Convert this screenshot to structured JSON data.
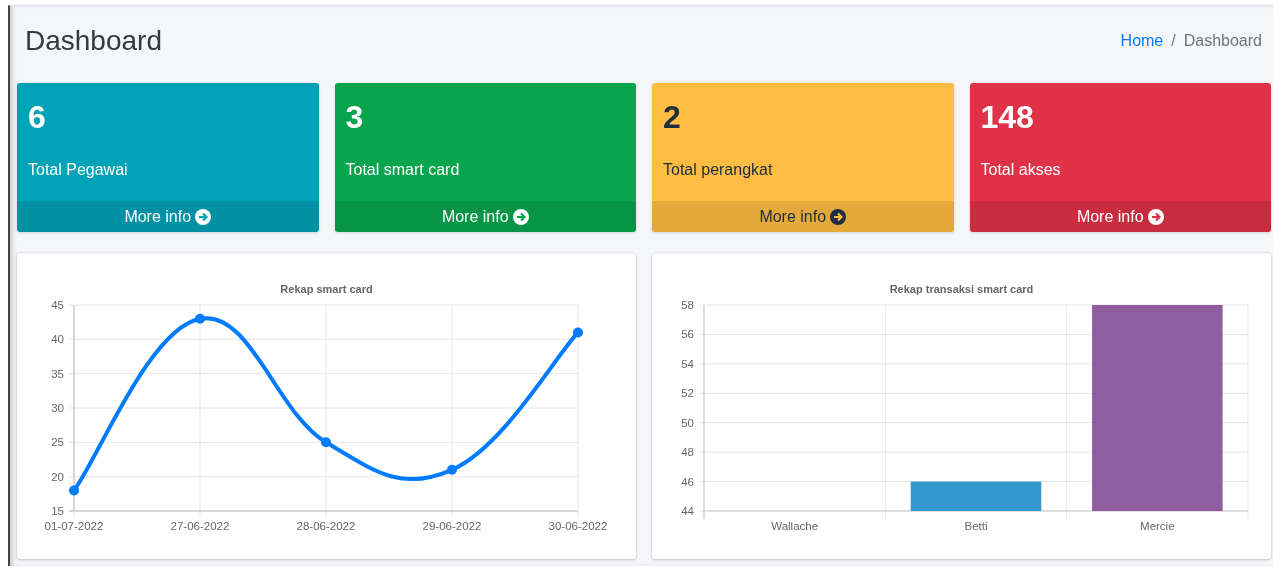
{
  "header": {
    "title": "Dashboard",
    "breadcrumb": {
      "home": "Home",
      "separator": "/",
      "current": "Dashboard"
    }
  },
  "stat_cards": [
    {
      "value": "6",
      "label": "Total Pegawai",
      "link": "More info",
      "kind": "info"
    },
    {
      "value": "3",
      "label": "Total smart card",
      "link": "More info",
      "kind": "success"
    },
    {
      "value": "2",
      "label": "Total perangkat",
      "link": "More info",
      "kind": "warning"
    },
    {
      "value": "148",
      "label": "Total akses",
      "link": "More info",
      "kind": "danger"
    }
  ],
  "charts": [
    {
      "chart_data": {
        "type": "line",
        "title": "Rekap smart card",
        "categories": [
          "01-07-2022",
          "27-06-2022",
          "28-06-2022",
          "29-06-2022",
          "30-06-2022"
        ],
        "series": [
          {
            "color": "#007bff",
            "marker": true,
            "values": [
              18,
              43,
              25,
              21,
              41
            ]
          }
        ],
        "grid": true,
        "ylim": [
          15,
          45
        ],
        "yticks": [
          15,
          20,
          25,
          30,
          35,
          40,
          45
        ]
      }
    },
    {
      "chart_data": {
        "type": "bar",
        "title": "Rekap transaksi smart card",
        "categories": [
          "Wallache",
          "Betti",
          "Mercie"
        ],
        "values": [
          null,
          46,
          58
        ],
        "colors": [
          null,
          "#3498cc",
          "#8e5e9e"
        ],
        "grid": true,
        "ylim": [
          44,
          58
        ],
        "yticks": [
          44,
          46,
          48,
          50,
          52,
          54,
          56,
          58
        ]
      }
    }
  ]
}
